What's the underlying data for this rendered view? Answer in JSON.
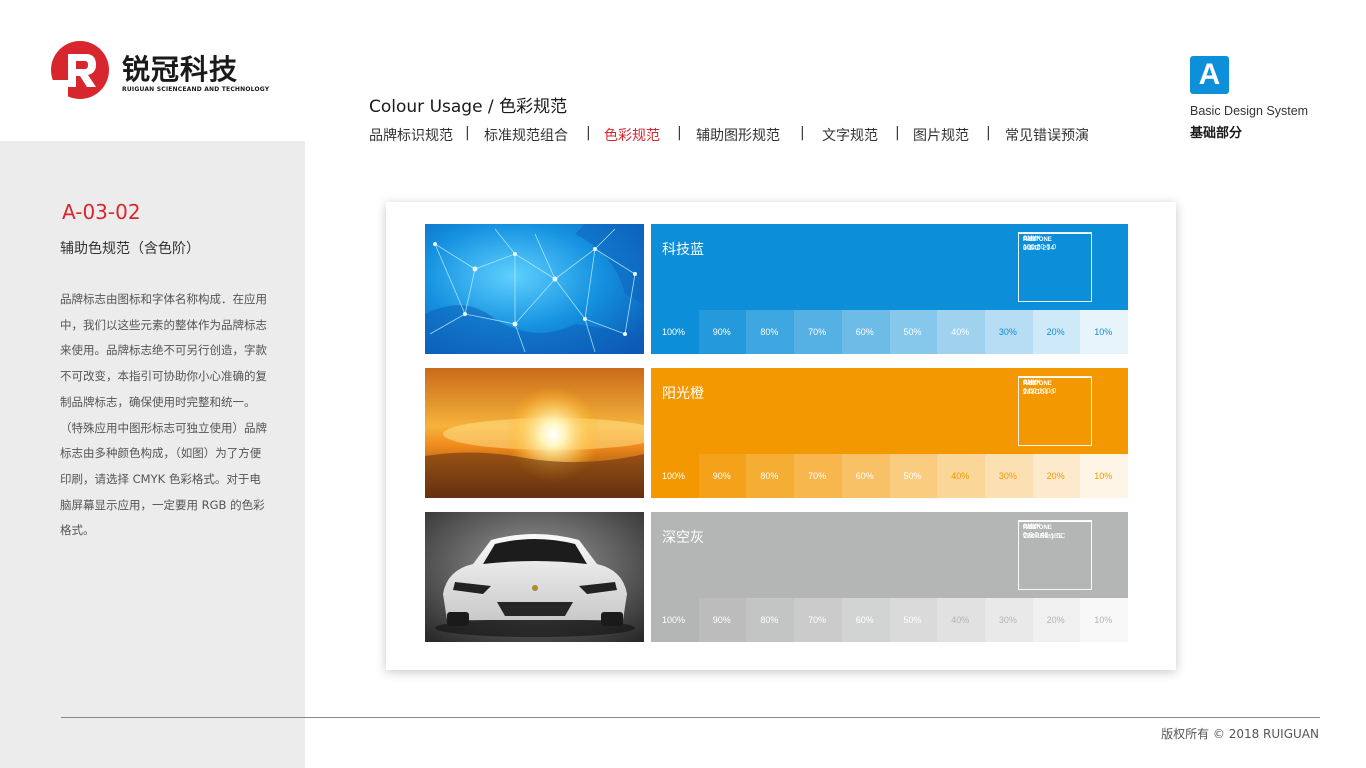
{
  "brand": {
    "name_cn": "锐冠科技",
    "name_en": "RUIGUAN SCIENCEAND AND TECHNOLOGY",
    "logo_letter": "R",
    "color_red": "#d8262e"
  },
  "page": {
    "code": "A-03-02",
    "subtitle": "辅助色规范（含色阶）",
    "body": "品牌标志由图标和字体名称构成．在应用中，我们以这些元素的整体作为品牌标志来使用。品牌标志绝不可另行创造，字款不可改变，本指引可协助你小心准确的复制品牌标志，确保使用时完整和统一。（特殊应用中图形标志可独立使用）品牌标志由多种颜色构成，（如图）为了方便印刷，请选择 CMYK 色彩格式。对于电脑屏幕显示应用，一定要用 RGB 的色彩格式。"
  },
  "header": {
    "title": "Colour Usage  /  色彩规范",
    "nav": [
      {
        "label": "品牌标识规范",
        "active": false
      },
      {
        "label": "标准规范组合",
        "active": false
      },
      {
        "label": "色彩规范",
        "active": true
      },
      {
        "label": "辅助图形规范",
        "active": false
      },
      {
        "label": "文字规范",
        "active": false
      },
      {
        "label": "图片规范",
        "active": false
      },
      {
        "label": "常见错误预演",
        "active": false
      }
    ],
    "separator": "|"
  },
  "badge": {
    "letter": "A",
    "title_en": "Basic  Design  System",
    "title_cn": "基础部分",
    "color": "#0d8fd9"
  },
  "colors": [
    {
      "name": "科技蓝",
      "image": "technology network globe",
      "hex": "#0c8fd8",
      "tint_text_color": "#ffffff",
      "cmyk_label": "CMYK",
      "cmyk": "100 20 0 0",
      "rgb_label": "RGB",
      "rgb": "0 140 214",
      "pantone_label": "PANTONE",
      "pantone": "361C",
      "tints": [
        "100%",
        "90%",
        "80%",
        "70%",
        "60%",
        "50%",
        "40%",
        "30%",
        "20%",
        "10%"
      ]
    },
    {
      "name": "阳光橙",
      "image": "sunrise over clouds",
      "hex": "#f39800",
      "tint_text_color": "#ffffff",
      "cmyk_label": "CMYK",
      "cmyk": "0  50  100  0",
      "rgb_label": "RGB",
      "rgb": "243  151  0",
      "pantone_label": "PANTONE",
      "pantone": "137C",
      "tints": [
        "100%",
        "90%",
        "80%",
        "70%",
        "60%",
        "50%",
        "40%",
        "30%",
        "20%",
        "10%"
      ]
    },
    {
      "name": "深空灰",
      "image": "white sports car",
      "hex": "#b4b5b5",
      "tint_text_color": "#ffffff",
      "cmyk_label": "CMYK",
      "cmyk": "0  0  0  40",
      "rgb_label": "RGB",
      "rgb": "180 181 181",
      "pantone_label": "PANTONE",
      "pantone": "Cool Gray 5C",
      "tints": [
        "100%",
        "90%",
        "80%",
        "70%",
        "60%",
        "50%",
        "40%",
        "30%",
        "20%",
        "10%"
      ]
    }
  ],
  "footer": {
    "text": "版权所有 ©   2018   RUIGUAN"
  }
}
